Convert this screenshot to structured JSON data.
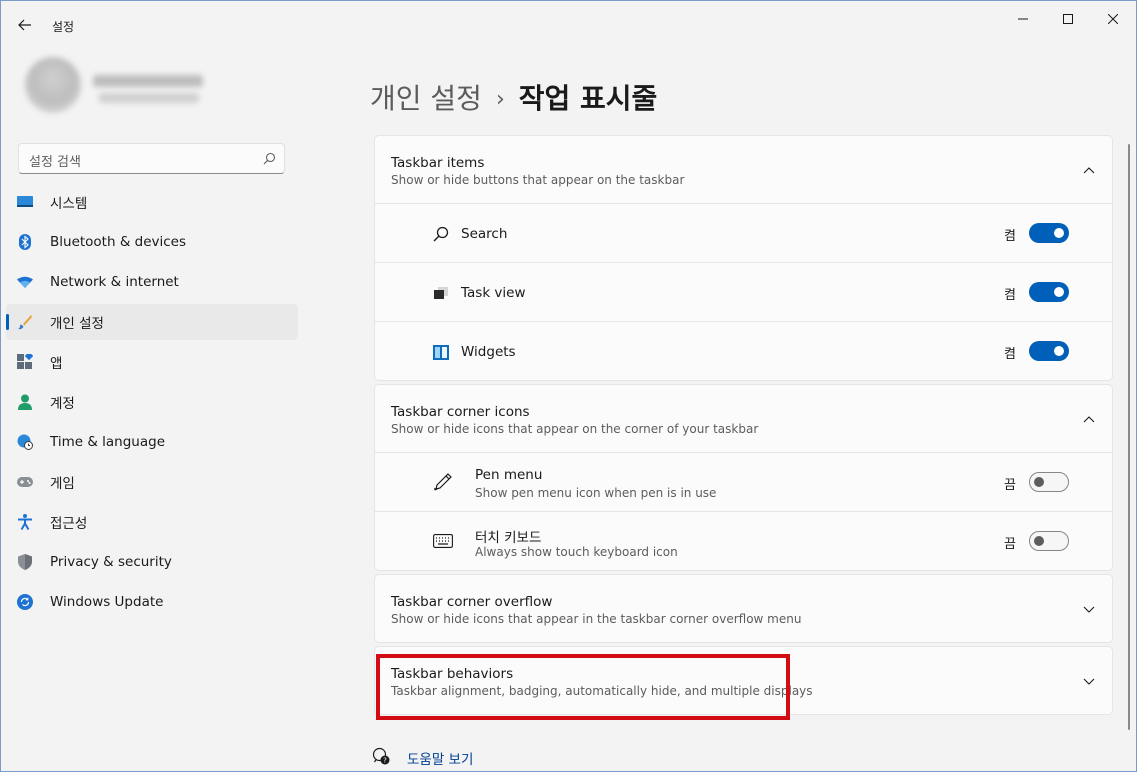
{
  "window": {
    "title": "설정"
  },
  "profile": {
    "name": "",
    "email": ""
  },
  "search": {
    "placeholder": "설정 검색"
  },
  "nav": {
    "items": [
      {
        "label": "시스템",
        "icon": "monitor-icon"
      },
      {
        "label": "Bluetooth & devices",
        "icon": "bluetooth-icon"
      },
      {
        "label": "Network & internet",
        "icon": "wifi-icon"
      },
      {
        "label": "개인 설정",
        "icon": "brush-icon",
        "active": true
      },
      {
        "label": "앱",
        "icon": "apps-icon"
      },
      {
        "label": "계정",
        "icon": "person-icon"
      },
      {
        "label": "Time & language",
        "icon": "globe-clock-icon"
      },
      {
        "label": "게임",
        "icon": "gamepad-icon"
      },
      {
        "label": "접근성",
        "icon": "accessibility-icon"
      },
      {
        "label": "Privacy & security",
        "icon": "shield-icon"
      },
      {
        "label": "Windows Update",
        "icon": "update-icon"
      }
    ]
  },
  "breadcrumb": {
    "parent": "개인 설정",
    "separator": "›",
    "current": "작업 표시줄"
  },
  "sections": {
    "taskbar_items": {
      "title": "Taskbar items",
      "description": "Show or hide buttons that appear on the taskbar",
      "rows": [
        {
          "label": "Search",
          "state": "켬",
          "on": true,
          "icon": "search-icon"
        },
        {
          "label": "Task view",
          "state": "켬",
          "on": true,
          "icon": "task-view-icon"
        },
        {
          "label": "Widgets",
          "state": "켬",
          "on": true,
          "icon": "widgets-icon"
        }
      ]
    },
    "corner_icons": {
      "title": "Taskbar corner icons",
      "description": "Show or hide icons that appear on the corner of your taskbar",
      "rows": [
        {
          "label": "Pen menu",
          "sub": "Show pen menu icon when pen is in use",
          "state": "끔",
          "on": false,
          "icon": "pen-icon"
        },
        {
          "label": "터치 키보드",
          "sub": "Always show touch keyboard icon",
          "state": "끔",
          "on": false,
          "icon": "keyboard-icon"
        }
      ]
    },
    "corner_overflow": {
      "title": "Taskbar corner overflow",
      "description": "Show or hide icons that appear in the taskbar corner overflow menu"
    },
    "behaviors": {
      "title": "Taskbar behaviors",
      "description": "Taskbar alignment, badging, automatically hide, and multiple displays"
    }
  },
  "help": {
    "label": "도움말 보기"
  },
  "colors": {
    "accent": "#005fb8",
    "highlight": "#d30b12",
    "link": "#003e92"
  }
}
